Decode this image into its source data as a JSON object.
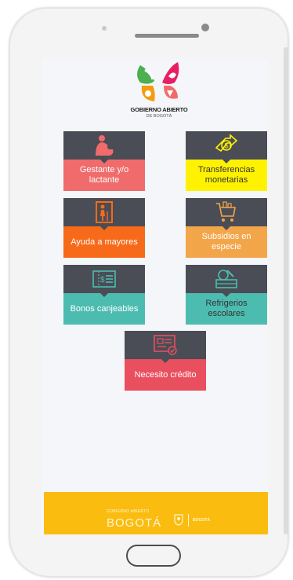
{
  "brand": {
    "logo_line1": "GOBIERNO ABIERTO",
    "logo_line2": "DE BOGOTÁ",
    "footer_small": "GOBIERNO ABIERTO",
    "footer_big": "BOGOTÁ",
    "footer_partner": "BOGOTÁ"
  },
  "colors": {
    "tile_top": "#4a4d55",
    "salmon": "#f06b6b",
    "yellow": "#fff200",
    "orange": "#f66a1a",
    "tan": "#f3a54a",
    "teal": "#4dbcb0",
    "pink": "#ea4f5f",
    "footer": "#fbbc10"
  },
  "tiles": [
    {
      "label": "Gestante y/o lactante",
      "icon": "mother-baby-icon"
    },
    {
      "label": "Transferencias monetarias",
      "icon": "money-transfer-icon"
    },
    {
      "label": "Ayuda a mayores",
      "icon": "elderly-icon"
    },
    {
      "label": "Subsidios en especie",
      "icon": "shopping-cart-icon"
    },
    {
      "label": "Bonos canjeables",
      "icon": "voucher-icon"
    },
    {
      "label": "Refrigerios escolares",
      "icon": "lunchbox-icon"
    },
    {
      "label": "Necesito crédito",
      "icon": "credit-card-icon"
    }
  ]
}
